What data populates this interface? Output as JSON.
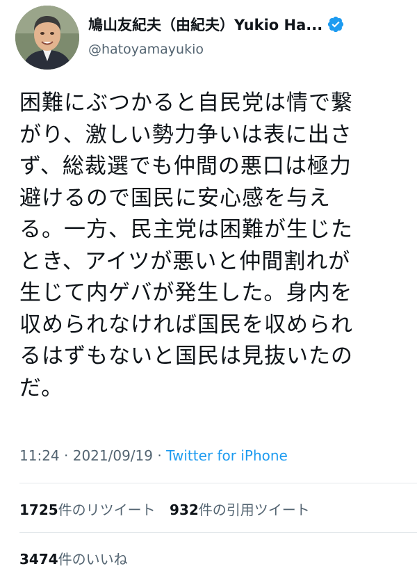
{
  "profile": {
    "display_name": "鳩山友紀夫（由紀夫）Yukio Ha...",
    "handle": "@hatoyamayukio",
    "verified_icon": "verified-badge-icon",
    "accent": "#1d9bf0"
  },
  "tweet": {
    "text": "困難にぶつかると自民党は情で繋\nがり、激しい勢力争いは表に出さ\nず、総裁選でも仲間の悪口は極力\n避けるので国民に安心感を与え\nる。一方、民主党は困難が生じた\nとき、アイツが悪いと仲間割れが\n生じて内ゲバが発生した。身内を\n収められなければ国民を収められ\nるはずもないと国民は見抜いたの\nだ。",
    "time": "11:24",
    "separator": " · ",
    "date": "2021/09/19",
    "separator2": " · ",
    "source": "Twitter for iPhone"
  },
  "stats": {
    "retweets_count": "1725",
    "retweets_label": "件のリツイート",
    "quotes_count": "932",
    "quotes_label": "件の引用ツイート",
    "likes_count": "3474",
    "likes_label": "件のいいね"
  }
}
